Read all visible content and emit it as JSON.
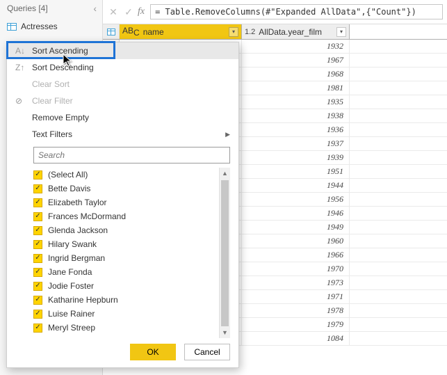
{
  "queries": {
    "header": "Queries [4]",
    "items": [
      {
        "label": "Actresses"
      }
    ]
  },
  "formula_bar": {
    "cancel_glyph": "✕",
    "confirm_glyph": "✓",
    "fx_label": "fx",
    "formula": "= Table.RemoveColumns(#\"Expanded AllData\",{\"Count\"})"
  },
  "columns": {
    "name": {
      "type_glyph": "AB",
      "subscript": "C",
      "label": "name"
    },
    "year": {
      "type_glyph": "1.2",
      "label": "AllData.year_film"
    }
  },
  "rows": [
    1932,
    1967,
    1968,
    1981,
    1935,
    1938,
    1936,
    1937,
    1939,
    1951,
    1944,
    1956,
    1946,
    1949,
    1960,
    1966,
    1970,
    1973,
    1971,
    1978,
    1979,
    1084
  ],
  "dropdown": {
    "sort_asc": "Sort Ascending",
    "sort_desc": "Sort Descending",
    "clear_sort": "Clear Sort",
    "clear_filter": "Clear Filter",
    "remove_empty": "Remove Empty",
    "text_filters": "Text Filters",
    "search_placeholder": "Search",
    "checks": [
      "(Select All)",
      "Bette Davis",
      "Elizabeth Taylor",
      "Frances McDormand",
      "Glenda Jackson",
      "Hilary Swank",
      "Ingrid Bergman",
      "Jane Fonda",
      "Jodie Foster",
      "Katharine Hepburn",
      "Luise Rainer",
      "Meryl Streep"
    ],
    "ok": "OK",
    "cancel": "Cancel"
  }
}
